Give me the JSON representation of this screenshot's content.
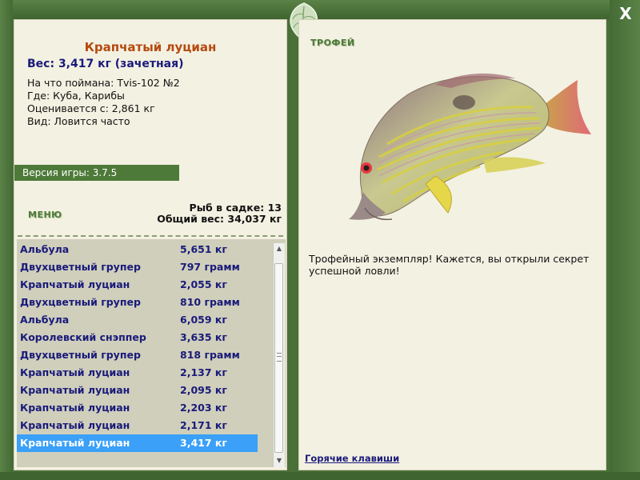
{
  "window": {
    "close_label": "X"
  },
  "fish_card": {
    "title": "Крапчатый луциан",
    "weight": "Вес: 3,417 кг (зачетная)",
    "caught_with": "На что поймана: Tvis-102 №2",
    "location": "Где: Куба, Карибы",
    "rated_from": "Оценивается с: 2,861 кг",
    "frequency": "Вид: Ловится часто"
  },
  "game_version": "Версия игры: 3.7.5",
  "menu_label": "МЕНЮ",
  "keepnet": {
    "count": "Рыб в садке: 13",
    "total_weight": "Общий вес: 34,037 кг"
  },
  "catch_list": [
    {
      "name": "Альбула",
      "weight": "5,651 кг"
    },
    {
      "name": "Двухцветный групер",
      "weight": "797 грамм"
    },
    {
      "name": "Крапчатый луциан",
      "weight": "2,055 кг"
    },
    {
      "name": "Двухцветный групер",
      "weight": "810 грамм"
    },
    {
      "name": "Альбула",
      "weight": "6,059 кг"
    },
    {
      "name": "Королевский снэппер",
      "weight": "3,635 кг"
    },
    {
      "name": "Двухцветный групер",
      "weight": "818 грамм"
    },
    {
      "name": "Крапчатый луциан",
      "weight": "2,137 кг"
    },
    {
      "name": "Крапчатый луциан",
      "weight": "2,095 кг"
    },
    {
      "name": "Крапчатый луциан",
      "weight": "2,203 кг"
    },
    {
      "name": "Крапчатый луциан",
      "weight": "2,171 кг"
    },
    {
      "name": "Крапчатый луциан",
      "weight": "3,417 кг",
      "selected": true
    }
  ],
  "trophy_label": "ТРОФЕЙ",
  "trophy_text": "Трофейный экземпляр! Кажется, вы открыли секрет успешной ловли!",
  "hotkeys_link": "Горячие клавиши",
  "icons": {
    "close": "close-icon",
    "decor": "leaf-icon",
    "fish": "fish-illustration"
  },
  "colors": {
    "frame": "#4a7038",
    "panel": "#f3f1e2",
    "title": "#b54a10",
    "list_text": "#1a1a7a",
    "selected": "#3aa0f8"
  }
}
